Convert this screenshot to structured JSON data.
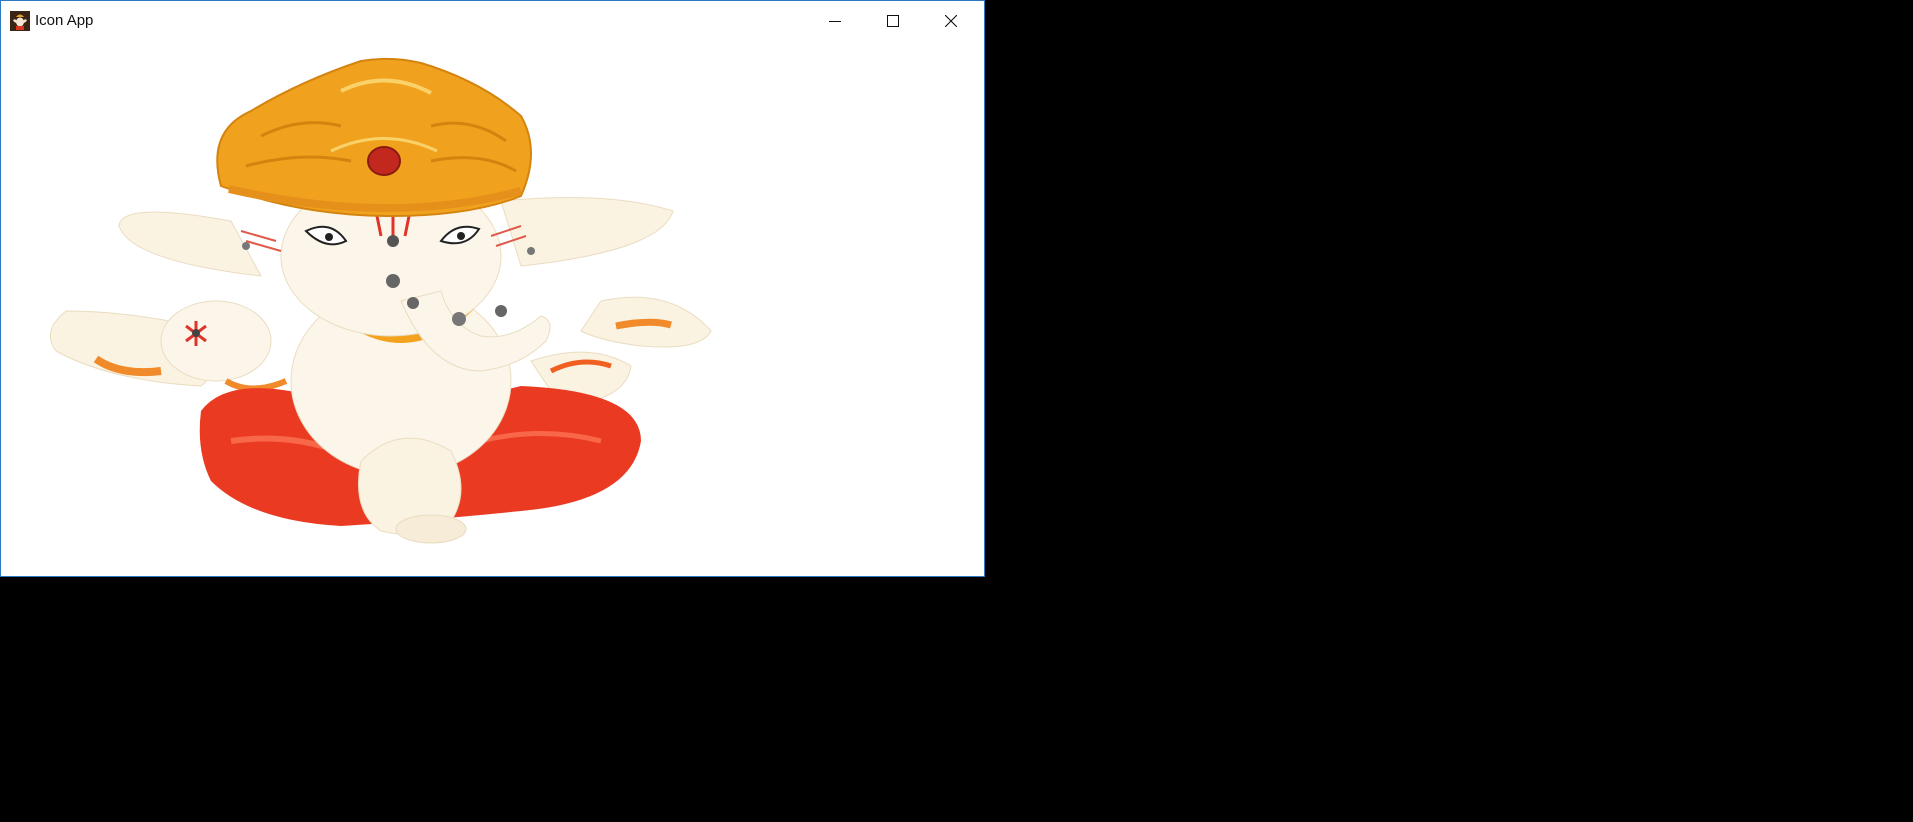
{
  "window": {
    "title": "Icon App",
    "accent_border": "#2b79c2"
  },
  "titlebar": {
    "app_icon": "ganesha-app-icon",
    "buttons": [
      {
        "name": "minimize",
        "icon": "minimize-icon"
      },
      {
        "name": "maximize",
        "icon": "maximize-icon"
      },
      {
        "name": "close",
        "icon": "close-icon"
      }
    ]
  },
  "content": {
    "image": "ganesha-idol-image",
    "colors": {
      "crown": "#f0a21e",
      "body": "#fbf3e2",
      "garment": "#ea3a22",
      "background": "#ffffff"
    }
  }
}
